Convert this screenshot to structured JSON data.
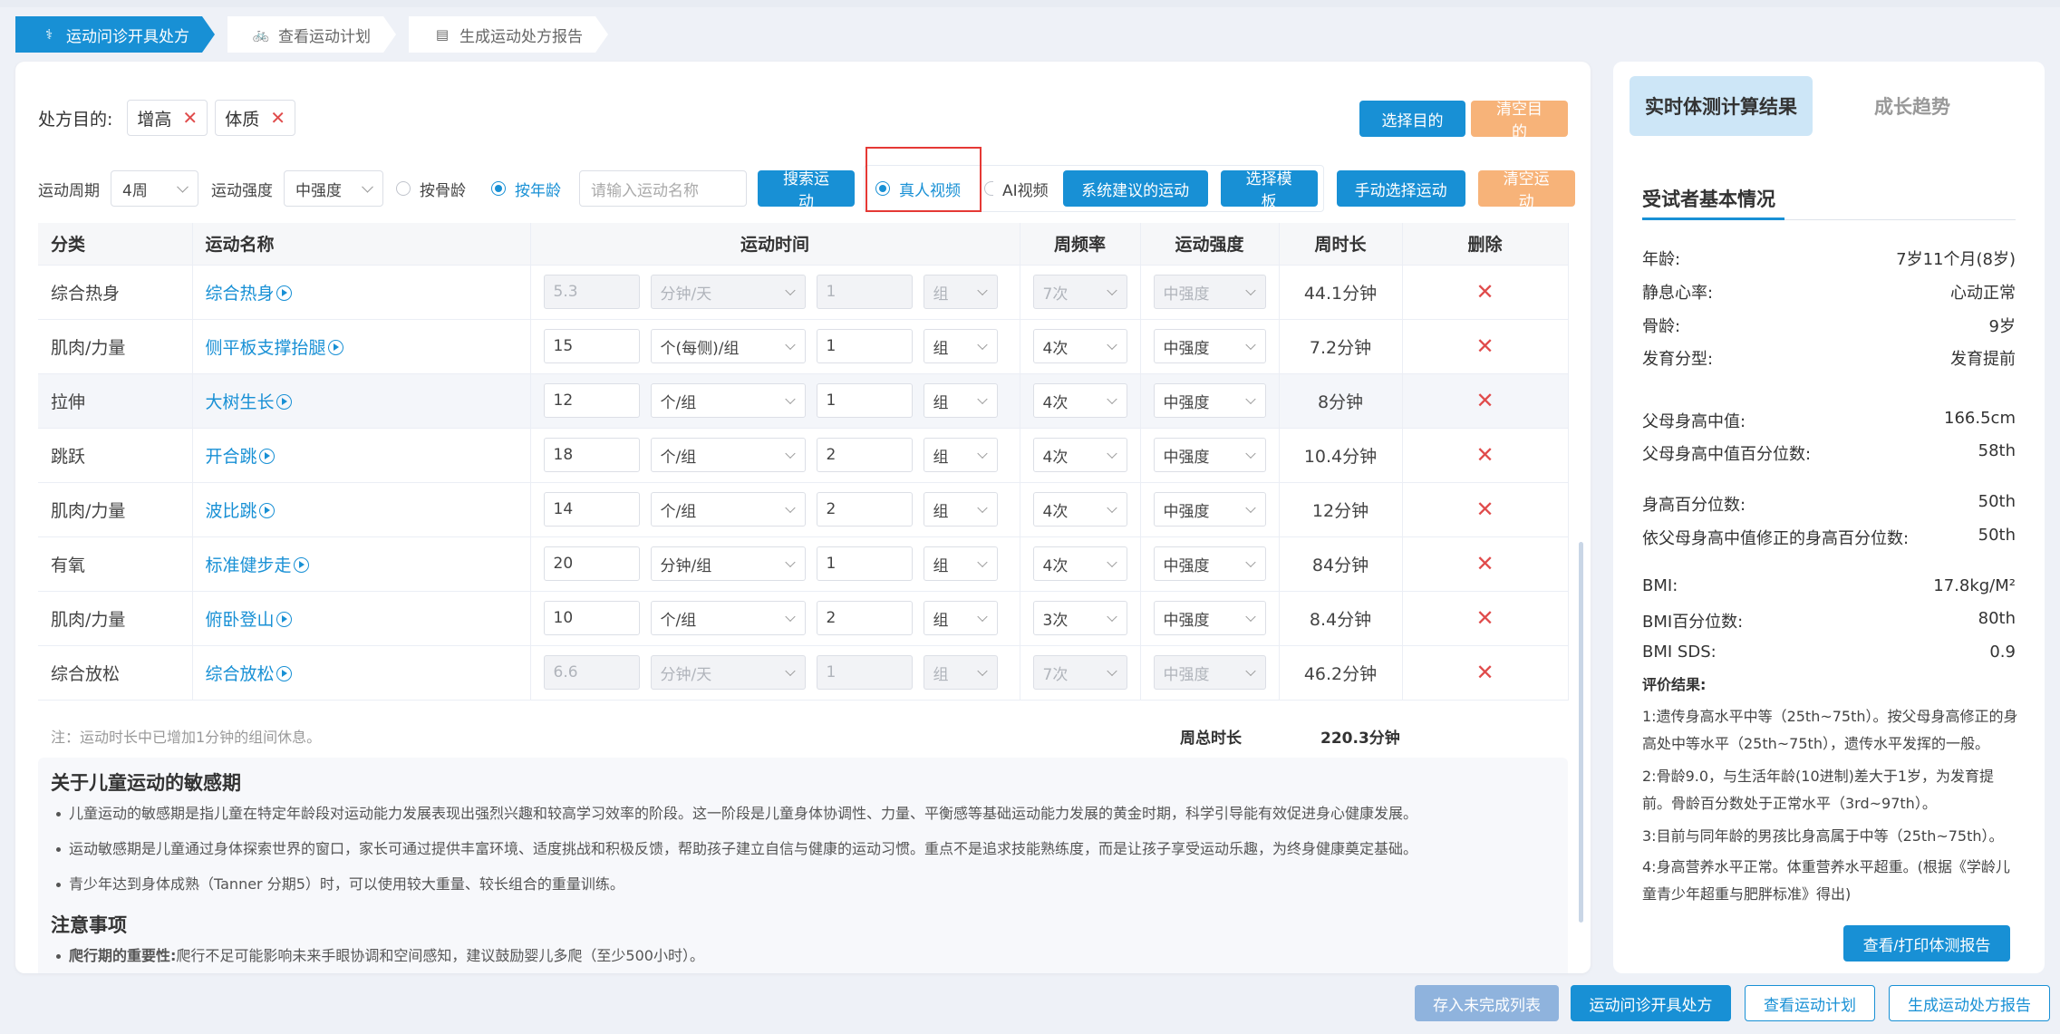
{
  "steps": [
    {
      "label": "运动问诊开具处方",
      "active": true
    },
    {
      "label": "查看运动计划",
      "active": false
    },
    {
      "label": "生成运动处方报告",
      "active": false
    }
  ],
  "purpose": {
    "label": "处方目的:",
    "tags": [
      "增高",
      "体质"
    ],
    "select_btn": "选择目的",
    "clear_btn": "清空目的"
  },
  "filters": {
    "period_label": "运动周期",
    "period_value": "4周",
    "intensity_label": "运动强度",
    "intensity_value": "中强度",
    "radio_bone": "按骨龄",
    "radio_age": "按年龄",
    "search_placeholder": "请输入运动名称",
    "search_btn": "搜索运动",
    "radio_real": "真人视频",
    "radio_ai": "AI视频",
    "suggest_btn": "系统建议的运动",
    "template_btn": "选择模板",
    "manual_btn": "手动选择运动",
    "clear_btn": "清空运动"
  },
  "table": {
    "headers": [
      "分类",
      "运动名称",
      "运动时间",
      "周频率",
      "运动强度",
      "周时长",
      "删除"
    ],
    "rows": [
      {
        "cat": "综合热身",
        "name": "综合热身",
        "amount": "5.3",
        "unit": "分钟/天",
        "sets": "1",
        "set_unit": "组",
        "freq": "7次",
        "intensity": "中强度",
        "duration": "44.1分钟",
        "disabled": true
      },
      {
        "cat": "肌肉/力量",
        "name": "侧平板支撑抬腿",
        "amount": "15",
        "unit": "个(每侧)/组",
        "sets": "1",
        "set_unit": "组",
        "freq": "4次",
        "intensity": "中强度",
        "duration": "7.2分钟",
        "disabled": false
      },
      {
        "cat": "拉伸",
        "name": "大树生长",
        "amount": "12",
        "unit": "个/组",
        "sets": "1",
        "set_unit": "组",
        "freq": "4次",
        "intensity": "中强度",
        "duration": "8分钟",
        "disabled": false
      },
      {
        "cat": "跳跃",
        "name": "开合跳",
        "amount": "18",
        "unit": "个/组",
        "sets": "2",
        "set_unit": "组",
        "freq": "4次",
        "intensity": "中强度",
        "duration": "10.4分钟",
        "disabled": false
      },
      {
        "cat": "肌肉/力量",
        "name": "波比跳",
        "amount": "14",
        "unit": "个/组",
        "sets": "2",
        "set_unit": "组",
        "freq": "4次",
        "intensity": "中强度",
        "duration": "12分钟",
        "disabled": false
      },
      {
        "cat": "有氧",
        "name": "标准健步走",
        "amount": "20",
        "unit": "分钟/组",
        "sets": "1",
        "set_unit": "组",
        "freq": "4次",
        "intensity": "中强度",
        "duration": "84分钟",
        "disabled": false
      },
      {
        "cat": "肌肉/力量",
        "name": "俯卧登山",
        "amount": "10",
        "unit": "个/组",
        "sets": "2",
        "set_unit": "组",
        "freq": "3次",
        "intensity": "中强度",
        "duration": "8.4分钟",
        "disabled": false
      },
      {
        "cat": "综合放松",
        "name": "综合放松",
        "amount": "6.6",
        "unit": "分钟/天",
        "sets": "1",
        "set_unit": "组",
        "freq": "7次",
        "intensity": "中强度",
        "duration": "46.2分钟",
        "disabled": true
      }
    ],
    "delete_symbol": "✕"
  },
  "note": {
    "text": "注：运动时长中已增加1分钟的组间休息。",
    "total_label": "周总时长",
    "total_value": "220.3分钟"
  },
  "info": {
    "title1": "关于儿童运动的敏感期",
    "bullets1": [
      "儿童运动的敏感期是指儿童在特定年龄段对运动能力发展表现出强烈兴趣和较高学习效率的阶段。这一阶段是儿童身体协调性、力量、平衡感等基础运动能力发展的黄金时期，科学引导能有效促进身心健康发展。",
      "运动敏感期是儿童通过身体探索世界的窗口，家长可通过提供丰富环境、适度挑战和积极反馈，帮助孩子建立自信与健康的运动习惯。重点不是追求技能熟练度，而是让孩子享受运动乐趣，为终身健康奠定基础。",
      "青少年达到身体成熟（Tanner 分期5）时，可以使用较大重量、较长组合的重量训练。"
    ],
    "title2": "注意事项",
    "bullet2_bold": "爬行期的重要性:",
    "bullet2_text": "爬行不足可能影响未来手眼协调和空间感知，建议鼓励婴儿多爬（至少500小时）。"
  },
  "side": {
    "tab_active": "实时体测计算结果",
    "tab_inactive": "成长趋势",
    "title": "受试者基本情况",
    "items": [
      {
        "k": "年龄:",
        "v": "7岁11个月(8岁)"
      },
      {
        "k": "静息心率:",
        "v": "心动正常"
      },
      {
        "k": "骨龄:",
        "v": "9岁"
      },
      {
        "k": "发育分型:",
        "v": "发育提前"
      },
      {
        "k": "父母身高中值:",
        "v": "166.5cm"
      },
      {
        "k": "父母身高中值百分位数:",
        "v": "58th"
      },
      {
        "k": "身高百分位数:",
        "v": "50th"
      },
      {
        "k": "依父母身高中值修正的身高百分位数:",
        "v": "50th"
      },
      {
        "k": "BMI:",
        "v": "17.8kg/M²"
      },
      {
        "k": "BMI百分位数:",
        "v": "80th"
      },
      {
        "k": "BMI SDS:",
        "v": "0.9"
      }
    ],
    "eval_title": "评价结果:",
    "eval": [
      "1:遗传身高水平中等（25th~75th）。按父母身高修正的身高处中等水平（25th~75th），遗传水平发挥的一般。",
      "2:骨龄9.0，与生活年龄(10进制)差大于1岁，为发育提前。骨龄百分数处于正常水平（3rd~97th）。",
      "3:目前与同年龄的男孩比身高属于中等（25th~75th）。",
      "4:身高营养水平正常。体重营养水平超重。(根据《学龄儿童青少年超重与肥胖标准》得出)"
    ],
    "print_btn": "查看/打印体测报告"
  },
  "bottom": {
    "save_btn": "存入未完成列表",
    "step1_btn": "运动问诊开具处方",
    "step2_btn": "查看运动计划",
    "step3_btn": "生成运动处方报告"
  }
}
